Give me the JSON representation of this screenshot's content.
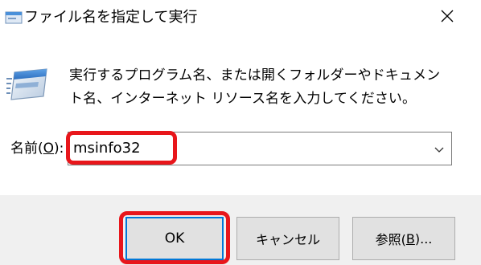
{
  "window": {
    "title": "ファイル名を指定して実行",
    "icons": {
      "app": "run-dialog-icon",
      "close": "close-icon",
      "main": "run-window-icon",
      "dropdown": "chevron-down-icon"
    }
  },
  "content": {
    "description": "実行するプログラム名、または開くフォルダーやドキュメント名、インターネット リソース名を入力してください。"
  },
  "name_field": {
    "label_prefix": "名前(",
    "label_mnemonic": "O",
    "label_suffix": "):",
    "value": "msinfo32"
  },
  "buttons": {
    "ok": "OK",
    "cancel": "キャンセル",
    "browse_prefix": "参照(",
    "browse_mnemonic": "B",
    "browse_suffix": ")..."
  },
  "colors": {
    "highlight": "#e8161b",
    "focus": "#0078d7",
    "footer_bg": "#f0f0f0",
    "button_bg": "#e1e1e1"
  }
}
